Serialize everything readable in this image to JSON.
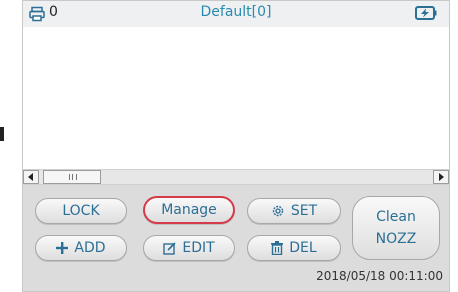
{
  "header": {
    "count": "0",
    "title": "Default[0]",
    "icons": {
      "printer": "printer-icon",
      "battery": "battery-charging-icon"
    }
  },
  "buttons": {
    "lock": "LOCK",
    "manage": "Manage",
    "set": "SET",
    "add": "ADD",
    "edit": "EDIT",
    "delete": "DEL",
    "clean_line1": "Clean",
    "clean_line2": "NOZZ"
  },
  "footer": {
    "datetime": "2018/05/18  00:11:00"
  },
  "colors": {
    "accent": "#2c6f96",
    "title": "#2a8ab0",
    "highlight": "#d43a48"
  }
}
